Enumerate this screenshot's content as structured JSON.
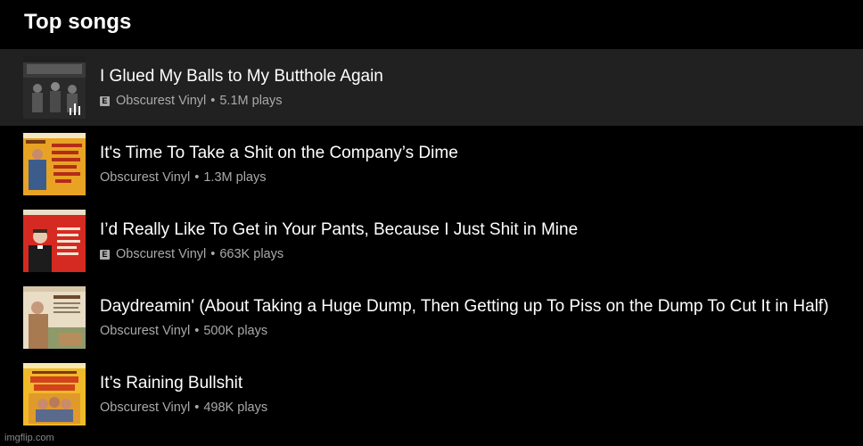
{
  "section": {
    "title": "Top songs"
  },
  "songs": [
    {
      "title": "I Glued My Balls to My Butthole Again",
      "artist": "Obscurest Vinyl",
      "plays": "5.1M plays",
      "explicit": true,
      "badge": "E",
      "now_playing": true,
      "thumb": {
        "bg": "#3a3a3a",
        "caption": "I GLUED MY BALLS TO MY BUTTHOLE AGAIN"
      }
    },
    {
      "title": "It's Time To Take a Shit on the Company’s Dime",
      "artist": "Obscurest Vinyl",
      "plays": "1.3M plays",
      "explicit": false,
      "now_playing": false,
      "thumb": {
        "bg": "#e8a324",
        "caption": "IT'S TIME TO TAKE A SHIT ON THE COMPANY'S DIME"
      }
    },
    {
      "title": "I’d Really Like To Get in Your Pants, Because I Just Shit in Mine",
      "artist": "Obscurest Vinyl",
      "plays": "663K plays",
      "explicit": true,
      "badge": "E",
      "now_playing": false,
      "thumb": {
        "bg": "#d42a22",
        "caption": "I'd really like to get in your pants, because I just shit in mine"
      }
    },
    {
      "title": "Daydreamin' (About Taking a Huge Dump, Then Getting up To Piss on the Dump To Cut It in Half)",
      "artist": "Obscurest Vinyl",
      "plays": "500K plays",
      "explicit": false,
      "now_playing": false,
      "thumb": {
        "bg": "#e9ddc6",
        "caption": "DAYDREAMIN'"
      }
    },
    {
      "title": "It’s Raining Bullshit",
      "artist": "Obscurest Vinyl",
      "plays": "498K plays",
      "explicit": false,
      "now_playing": false,
      "thumb": {
        "bg": "#f0b928",
        "caption": "IT'S RAINING BULLSHIT"
      }
    }
  ],
  "separator": "•",
  "watermark": "imgflip.com",
  "colors": {
    "background": "#000000",
    "active_row": "#212121",
    "meta_text": "#aaaaaa"
  }
}
